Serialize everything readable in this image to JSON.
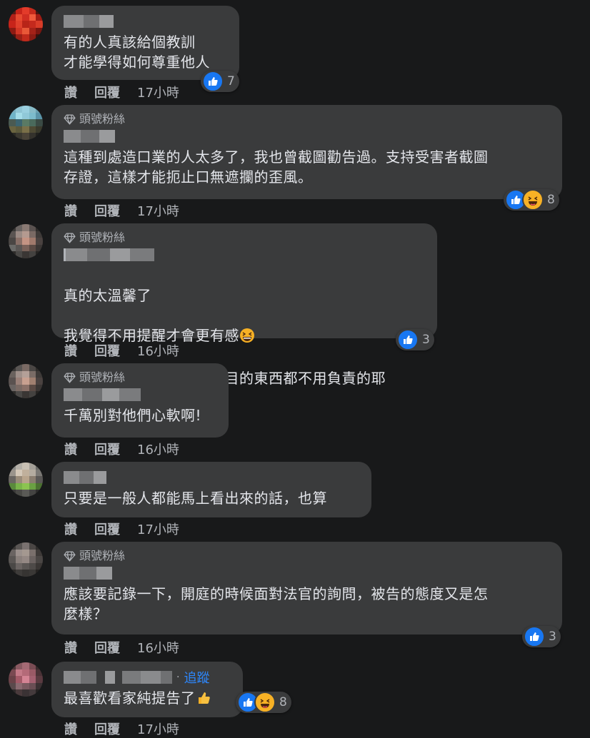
{
  "actions": {
    "like_label": "讚",
    "reply_label": "回覆"
  },
  "badge_label": "頭號粉絲",
  "follow_label": "追蹤",
  "colors": {
    "background": "#18191a",
    "bubble": "#3a3b3c",
    "link": "#2d88ff",
    "like": "#1877f2",
    "haha": "#f7b125"
  },
  "comments": [
    {
      "text": "有的人真該給個教訓\n才能學得如何尊重他人",
      "time": "17小時",
      "reaction_count": "7",
      "reactions": [
        "like"
      ]
    },
    {
      "badge": true,
      "text": "這種到處造口業的人太多了，我也曾截圖勸告過。支持受害者截圖\n存證，這樣才能扼止口無遮攔的歪風。",
      "time": "17小時",
      "reaction_count": "8",
      "reactions": [
        "like",
        "haha"
      ]
    },
    {
      "badge": true,
      "text_lines": [
        "真的太溫馨了",
        "我覺得不用提醒才會更有感",
        "要不然以為寫這種不堪入目的東西都不用負責的耶"
      ],
      "emoji": "grinning-squinting-face",
      "time": "16小時",
      "reaction_count": "3",
      "reactions": [
        "like"
      ]
    },
    {
      "badge": true,
      "text": "千萬別對他們心軟啊!",
      "time": "16小時"
    },
    {
      "text": "只要是一般人都能馬上看出來的話，也算",
      "time": "17小時"
    },
    {
      "badge": true,
      "text": "應該要記錄一下，開庭的時候面對法官的詢問，被告的態度又是怎\n麼樣？",
      "time": "16小時",
      "reaction_count": "3",
      "reactions": [
        "like"
      ]
    },
    {
      "follow": true,
      "text": "最喜歡看家純提告了",
      "emoji": "thumbs-up",
      "time": "17小時",
      "reaction_count": "8",
      "reactions": [
        "like",
        "haha"
      ]
    }
  ]
}
